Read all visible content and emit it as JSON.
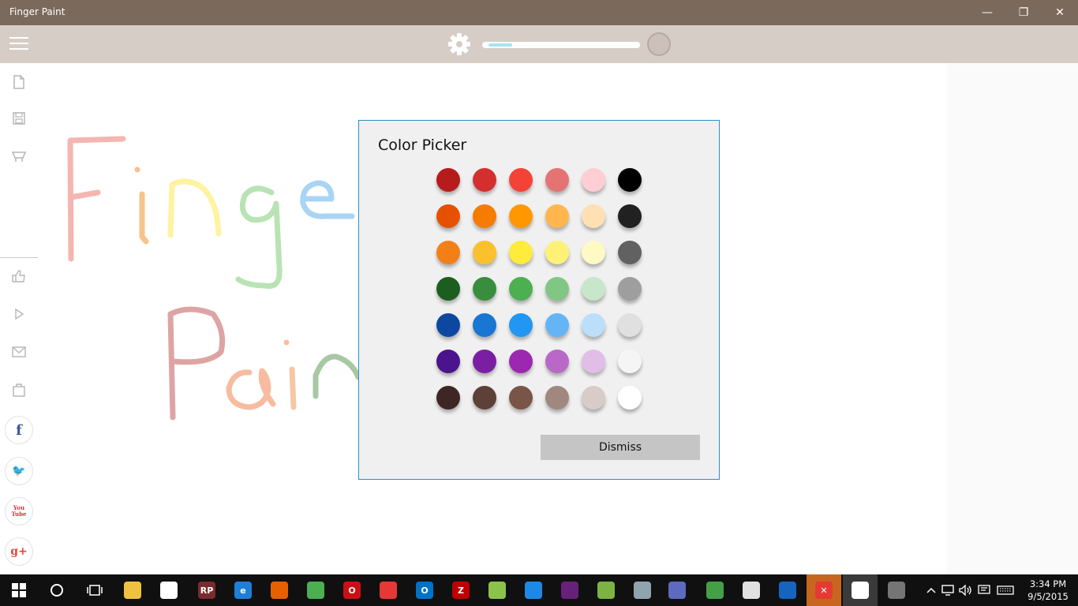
{
  "window": {
    "title": "Finger Paint",
    "minimize_glyph": "—",
    "restore_glyph": "❐",
    "close_glyph": "✕"
  },
  "toolbar": {
    "brush_size": 0.1,
    "current_color": "#cdbfb9"
  },
  "sidebar": {
    "top_icons": [
      "new-file-icon",
      "save-icon",
      "clear-bucket-icon"
    ],
    "bottom_icons": [
      "like-icon",
      "play-icon",
      "mail-icon",
      "store-bag-icon"
    ],
    "social": [
      {
        "name": "facebook",
        "glyph": "f",
        "color": "#3b5998"
      },
      {
        "name": "twitter",
        "glyph": "🐦",
        "color": "#1da1f2"
      },
      {
        "name": "youtube",
        "glyph": "You Tube",
        "color": "#cc3333"
      },
      {
        "name": "google-plus",
        "glyph": "g+",
        "color": "#dd4b39"
      }
    ]
  },
  "dialog": {
    "title": "Color Picker",
    "dismiss_label": "Dismiss",
    "colors": [
      [
        "#b71c1c",
        "#d32f2f",
        "#f44336",
        "#e57373",
        "#ffcdd2",
        "#000000"
      ],
      [
        "#e65100",
        "#f57c00",
        "#ff9800",
        "#ffb74d",
        "#ffe0b2",
        "#212121"
      ],
      [
        "#f57f17",
        "#fbc02d",
        "#ffeb3b",
        "#fff176",
        "#fff9c4",
        "#616161"
      ],
      [
        "#1b5e20",
        "#388e3c",
        "#4caf50",
        "#81c784",
        "#c8e6c9",
        "#9e9e9e"
      ],
      [
        "#0d47a1",
        "#1976d2",
        "#2196f3",
        "#64b5f6",
        "#bbdefb",
        "#e0e0e0"
      ],
      [
        "#4a148c",
        "#7b1fa2",
        "#9c27b0",
        "#ba68c8",
        "#e1bee7",
        "#f5f5f5"
      ],
      [
        "#3e2723",
        "#5d4037",
        "#795548",
        "#a1887f",
        "#d7ccc8",
        "#ffffff"
      ]
    ]
  },
  "taskbar": {
    "apps": [
      {
        "name": "file-explorer",
        "label": "",
        "color": "#f0c040"
      },
      {
        "name": "store",
        "label": "",
        "color": "#ffffff"
      },
      {
        "name": "rp-chat",
        "label": "RP",
        "color": "#7a2b2b"
      },
      {
        "name": "edge",
        "label": "e",
        "color": "#1e7fd8"
      },
      {
        "name": "firefox",
        "label": "",
        "color": "#e66000"
      },
      {
        "name": "chrome",
        "label": "",
        "color": "#4caf50"
      },
      {
        "name": "opera",
        "label": "O",
        "color": "#cc0f16"
      },
      {
        "name": "paint-app",
        "label": "",
        "color": "#e53935"
      },
      {
        "name": "outlook",
        "label": "O",
        "color": "#0072c6"
      },
      {
        "name": "filezilla",
        "label": "Z",
        "color": "#bf0000"
      },
      {
        "name": "notepad-plus",
        "label": "",
        "color": "#8bc34a"
      },
      {
        "name": "vscode",
        "label": "",
        "color": "#1e88e5"
      },
      {
        "name": "visual-studio",
        "label": "",
        "color": "#68217a"
      },
      {
        "name": "android-tool",
        "label": "",
        "color": "#7cb342"
      },
      {
        "name": "ink-tool",
        "label": "",
        "color": "#90a4ae"
      },
      {
        "name": "screen-tool",
        "label": "",
        "color": "#5c6bc0"
      },
      {
        "name": "android-studio",
        "label": "",
        "color": "#43a047"
      },
      {
        "name": "snipping-tool",
        "label": "",
        "color": "#e0e0e0"
      },
      {
        "name": "network-tool",
        "label": "",
        "color": "#1565c0"
      },
      {
        "name": "x-app",
        "label": "✕",
        "color": "#e53935"
      },
      {
        "name": "finger-paint",
        "label": "",
        "color": "#ffffff"
      },
      {
        "name": "device-app",
        "label": "",
        "color": "#757575"
      }
    ],
    "time": "3:34 PM",
    "date": "9/5/2015"
  }
}
